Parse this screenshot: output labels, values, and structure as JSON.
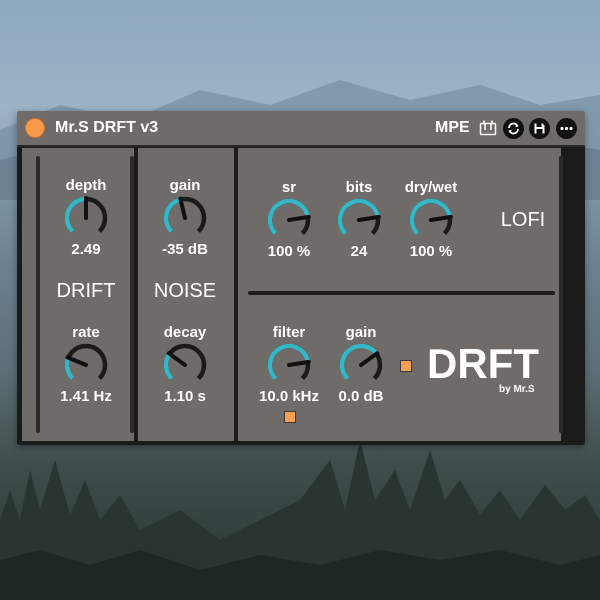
{
  "window": {
    "title": "Mr.S DRFT v3",
    "mpe_label": "MPE"
  },
  "drift": {
    "section_label": "DRIFT",
    "depth": {
      "label": "depth",
      "value": "2.49",
      "level": 0.5
    },
    "rate": {
      "label": "rate",
      "value": "1.41 Hz",
      "level": 0.25
    }
  },
  "noise": {
    "section_label": "NOISE",
    "gain": {
      "label": "gain",
      "value": "-35 dB",
      "level": 0.45
    },
    "decay": {
      "label": "decay",
      "value": "1.10 s",
      "level": 0.3
    }
  },
  "lofi": {
    "section_label": "LOFI",
    "sr": {
      "label": "sr",
      "value": "100 %",
      "level": 0.8
    },
    "bits": {
      "label": "bits",
      "value": "24",
      "level": 0.8
    },
    "drywet": {
      "label": "dry/wet",
      "value": "100 %",
      "level": 0.8
    }
  },
  "filter": {
    "filter": {
      "label": "filter",
      "value": "10.0 kHz",
      "level": 0.8
    },
    "gain": {
      "label": "gain",
      "value": "0.0 dB",
      "level": 0.7
    }
  },
  "brand": {
    "logo": "DRFT",
    "byline": "by Mr.S"
  },
  "colors": {
    "accent": "#35b7c7",
    "orange": "#f59a4a",
    "panel": "#6e6b69",
    "dark": "#1b1b1b"
  }
}
